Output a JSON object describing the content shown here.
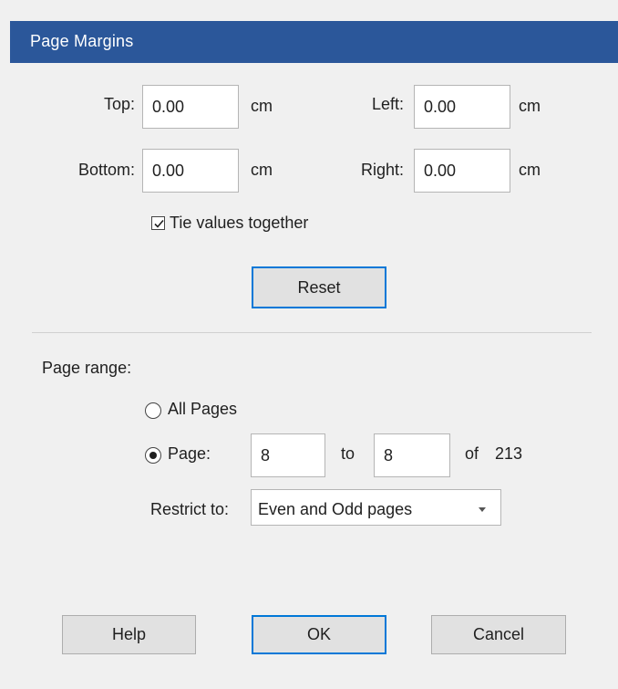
{
  "window": {
    "title": "Page Margins"
  },
  "margins": {
    "top_label": "Top:",
    "top_value": "0.00",
    "left_label": "Left:",
    "left_value": "0.00",
    "bottom_label": "Bottom:",
    "bottom_value": "0.00",
    "right_label": "Right:",
    "right_value": "0.00",
    "unit": "cm",
    "tie_label": "Tie values together",
    "tie_checked": true,
    "reset_label": "Reset"
  },
  "page_range": {
    "heading": "Page range:",
    "all_pages_label": "All Pages",
    "page_label": "Page:",
    "selected": "page",
    "from_value": "8",
    "to_label": "to",
    "to_value": "8",
    "of_label": "of",
    "total": "213",
    "restrict_label": "Restrict to:",
    "restrict_value": "Even and Odd pages"
  },
  "buttons": {
    "help": "Help",
    "ok": "OK",
    "cancel": "Cancel"
  },
  "colors": {
    "title_bar": "#2b579a",
    "focus_border": "#0078d7",
    "dialog_bg": "#f0f0f0"
  }
}
